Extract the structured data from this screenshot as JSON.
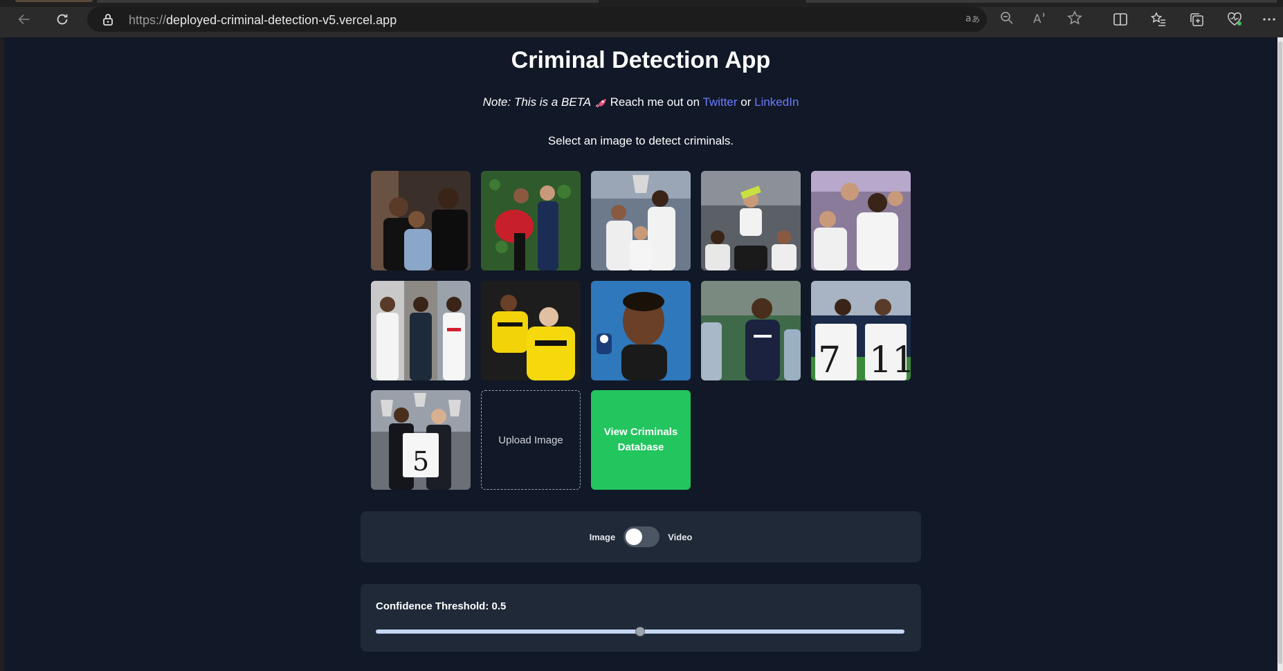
{
  "browser": {
    "url_protocol": "https://",
    "url_host": "deployed-criminal-detection-v5.vercel.app",
    "toolbar_icons": [
      "translate-icon",
      "zoom-out-icon",
      "read-aloud-icon",
      "favorite-star-icon",
      "split-screen-icon",
      "favorites-icon",
      "collections-icon",
      "browser-essentials-icon",
      "more-icon"
    ]
  },
  "page": {
    "title": "Criminal Detection App",
    "note_prefix": "Note: This is a BETA",
    "note_reach": "Reach me out on",
    "twitter_label": "Twitter",
    "note_or": "or",
    "linkedin_label": "LinkedIn",
    "prompt": "Select an image to detect criminals."
  },
  "gallery": {
    "images": [
      {
        "name": "sample-image-1",
        "bg": "#3b2f2a"
      },
      {
        "name": "sample-image-2",
        "bg": "#2f5a2b"
      },
      {
        "name": "sample-image-3",
        "bg": "#6c7a8c"
      },
      {
        "name": "sample-image-4",
        "bg": "#5b5f66"
      },
      {
        "name": "sample-image-5",
        "bg": "#8a7b9a"
      },
      {
        "name": "sample-image-6",
        "bg": "#c9c9c9"
      },
      {
        "name": "sample-image-7",
        "bg": "#1d1d1d"
      },
      {
        "name": "sample-image-8",
        "bg": "#2a6fb0"
      },
      {
        "name": "sample-image-9",
        "bg": "#3e6a4a"
      },
      {
        "name": "sample-image-10",
        "bg": "#1a2a48"
      },
      {
        "name": "sample-image-11",
        "bg": "#6a6f78"
      }
    ],
    "upload_label": "Upload Image",
    "database_label": "View Criminals Database"
  },
  "mode": {
    "left_label": "Image",
    "right_label": "Video",
    "selected": "Image"
  },
  "threshold": {
    "label": "Confidence Threshold: 0.5",
    "value": 0.5,
    "min": 0,
    "max": 1
  },
  "colors": {
    "page_bg": "#111827",
    "panel_bg": "#1f2937",
    "link": "#6b7cff",
    "database_button": "#22c55e"
  }
}
